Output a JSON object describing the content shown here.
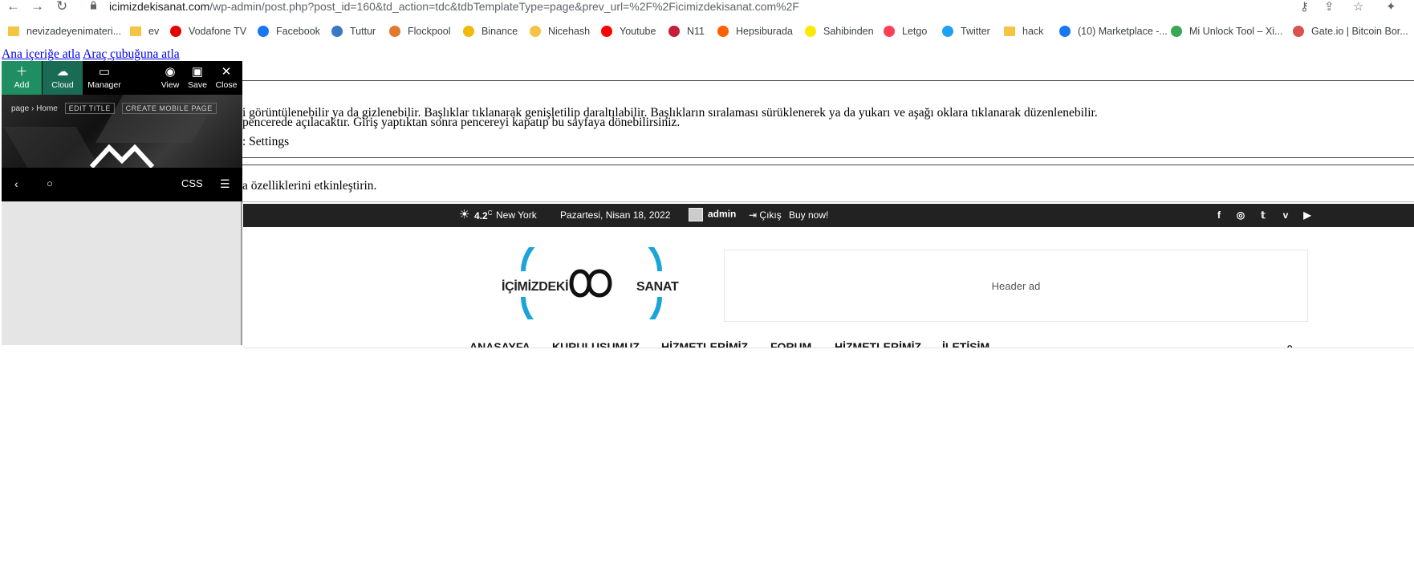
{
  "browser": {
    "url_host": "icimizdekisanat.com",
    "url_path": "/wp-admin/post.php?post_id=160&td_action=tdc&tdbTemplateType=page&prev_url=%2F%2Ficimizdekisanat.com%2F",
    "bookmarks": [
      {
        "label": "nevizadeyenimateri...",
        "icon": "folder-icon",
        "color": "#f4c542"
      },
      {
        "label": "ev",
        "icon": "folder-icon",
        "color": "#f4c542"
      },
      {
        "label": "Vodafone TV",
        "icon": "vodafone-icon",
        "color": "#e60000"
      },
      {
        "label": "Facebook",
        "icon": "facebook-icon",
        "color": "#1877f2"
      },
      {
        "label": "Tuttur",
        "icon": "tuttur-icon",
        "color": "#3a78c3"
      },
      {
        "label": "Flockpool",
        "icon": "flockpool-icon",
        "color": "#e07a2e"
      },
      {
        "label": "Binance",
        "icon": "binance-icon",
        "color": "#f0b90b"
      },
      {
        "label": "Nicehash",
        "icon": "nicehash-icon",
        "color": "#f6c244"
      },
      {
        "label": "Youtube",
        "icon": "youtube-icon",
        "color": "#ff0000"
      },
      {
        "label": "N11",
        "icon": "n11-icon",
        "color": "#c21f3a"
      },
      {
        "label": "Hepsiburada",
        "icon": "hepsiburada-icon",
        "color": "#ff6000"
      },
      {
        "label": "Sahibinden",
        "icon": "sahibinden-icon",
        "color": "#ffe800"
      },
      {
        "label": "Letgo",
        "icon": "letgo-icon",
        "color": "#ff3f55"
      },
      {
        "label": "Twitter",
        "icon": "twitter-icon",
        "color": "#1da1f2"
      },
      {
        "label": "hack",
        "icon": "folder-icon",
        "color": "#f4c542"
      },
      {
        "label": "(10) Marketplace -...",
        "icon": "facebook-icon",
        "color": "#1877f2"
      },
      {
        "label": "Mi Unlock Tool – Xi...",
        "icon": "mi-unlock-icon",
        "color": "#3aa757"
      },
      {
        "label": "Gate.io | Bitcoin Bor...",
        "icon": "gateio-icon",
        "color": "#d9534f"
      }
    ]
  },
  "wp": {
    "skip_content": "Ana içeriğe atla",
    "skip_toolbar": "Araç çubuğuna atla",
    "help_line1": "i görüntülenebilir ya da gizlenebilir. Başlıklar tıklanarak genişletilip daraltılabilir. Başlıkların sıralaması sürüklenerek ya da yukarı ve aşağı oklara tıklanarak düzenlenebilir.",
    "help_line2": "pencerede açılacaktır. Giriş yaptıktan sonra pencereyi kapatıp bu sayfaya dönebilirsiniz.",
    "settings": ": Settings",
    "enable_text": "a özelliklerini etkinleştirin."
  },
  "editor": {
    "tools": {
      "add": "Add",
      "cloud": "Cloud",
      "manager": "Manager",
      "view": "View",
      "save": "Save",
      "close": "Close"
    },
    "breadcrumb_root": "page",
    "breadcrumb_sep": "›",
    "breadcrumb_current": "Home",
    "edit_title": "EDIT TITLE",
    "create_mobile": "CREATE MOBILE PAGE",
    "css_label": "CSS"
  },
  "site": {
    "temperature": "4.2",
    "temp_unit": "C",
    "city": "New York",
    "date": "Pazartesi, Nisan 18, 2022",
    "user": "admin",
    "logout": "Çıkış",
    "buy": "Buy now!",
    "logo_left": "İÇİMİZDEKİ",
    "logo_right": "SANAT",
    "header_ad": "Header ad",
    "menu": [
      "ANASAYFA",
      "KURULUŞUMUZ",
      "HİZMETLERİMİZ",
      "FORUM",
      "HİZMETLERİMİZ",
      "İLETİŞİM"
    ]
  },
  "colors": {
    "accent_green": "#1f8f63",
    "topbar": "#222222",
    "logo_blue": "#1ba4d8"
  }
}
